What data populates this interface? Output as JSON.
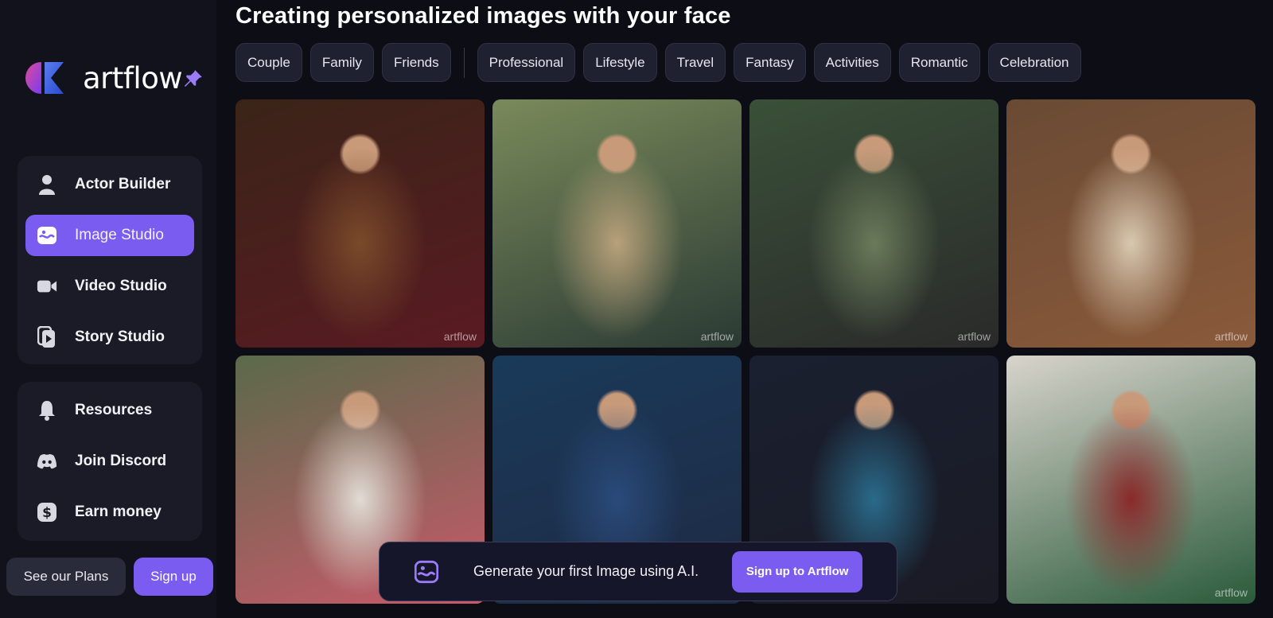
{
  "header": {
    "title": "Creating personalized images with your face"
  },
  "brand": {
    "name": "artflow"
  },
  "categories": [
    "Couple",
    "Family",
    "Friends",
    "Professional",
    "Lifestyle",
    "Travel",
    "Fantasy",
    "Activities",
    "Romantic",
    "Celebration"
  ],
  "sidebar": {
    "primary": [
      {
        "label": "Actor Builder",
        "icon": "person-icon"
      },
      {
        "label": "Image Studio",
        "icon": "image-icon",
        "active": true
      },
      {
        "label": "Video Studio",
        "icon": "video-camera-icon"
      },
      {
        "label": "Story Studio",
        "icon": "story-icon"
      }
    ],
    "secondary": [
      {
        "label": "Resources",
        "icon": "bell-icon"
      },
      {
        "label": "Join Discord",
        "icon": "discord-icon"
      },
      {
        "label": "Earn money",
        "icon": "dollar-icon"
      }
    ],
    "plans_label": "See our Plans",
    "signup_label": "Sign up"
  },
  "gallery": {
    "watermark": "artflow",
    "images": [
      {
        "name": "couple-dancing-image",
        "colors": [
          "#3a2418",
          "#7a4a2a",
          "#5a1a22"
        ]
      },
      {
        "name": "woman-trench-coat-image",
        "colors": [
          "#7a8a5a",
          "#b8a07a",
          "#2a3a34"
        ]
      },
      {
        "name": "samurai-bamboo-image",
        "colors": [
          "#3a5038",
          "#6a7a5a",
          "#2a2a2a"
        ]
      },
      {
        "name": "woman-sweater-cozy-image",
        "colors": [
          "#6a4a34",
          "#d8c8b0",
          "#8a5a3a"
        ]
      },
      {
        "name": "mother-son-flowers-image",
        "colors": [
          "#5a6a4a",
          "#e0dcd4",
          "#c85a6a"
        ]
      },
      {
        "name": "man-stock-exchange-image",
        "colors": [
          "#1a3a5a",
          "#2a4a7a",
          "#1e2a44"
        ]
      },
      {
        "name": "teen-trading-desk-image",
        "colors": [
          "#1a2030",
          "#2a6a8a",
          "#1a1a24"
        ]
      },
      {
        "name": "man-christmas-gifts-image",
        "colors": [
          "#d8d4cc",
          "#8a2a2a",
          "#2a5a3a"
        ]
      }
    ]
  },
  "banner": {
    "text": "Generate your first Image using A.I.",
    "button_label": "Sign up to Artflow"
  },
  "colors": {
    "accent": "#7a5cf0",
    "background": "#0d0d16",
    "sidebar": "#12121c",
    "panel": "#1b1b27"
  }
}
